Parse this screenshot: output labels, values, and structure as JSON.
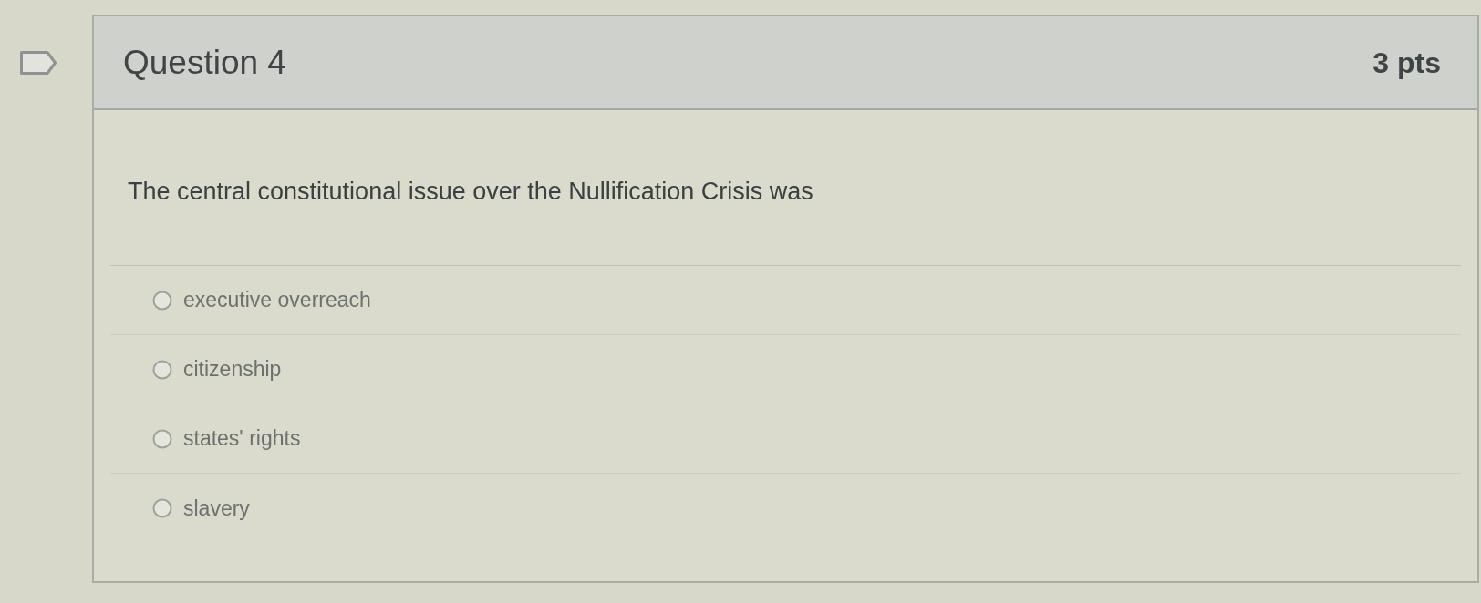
{
  "question": {
    "flagged": false,
    "title": "Question 4",
    "points": "3 pts",
    "text": "The central constitutional issue over the Nullification Crisis was",
    "answers": [
      {
        "label": "executive overreach",
        "selected": false
      },
      {
        "label": "citizenship",
        "selected": false
      },
      {
        "label": "states' rights",
        "selected": false
      },
      {
        "label": "slavery",
        "selected": false
      }
    ]
  }
}
